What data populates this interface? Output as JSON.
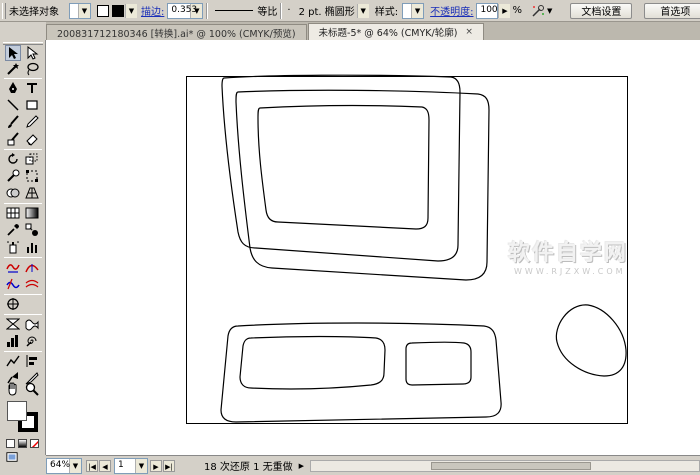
{
  "control_bar": {
    "selection_label": "未选择对象",
    "stroke_label": "描边:",
    "stroke_weight": "0.353",
    "profile_label": "等比",
    "brush_label": "2 pt. 椭圆形",
    "brush_dot": "·",
    "style_label": "样式:",
    "opacity_label": "不透明度:",
    "opacity_value": "100",
    "percent": "%",
    "doc_setup_button": "文档设置",
    "prefs_button": "首选项"
  },
  "tabs": [
    {
      "label": "2008317121803​46 [转换].ai* @ 100% (CMYK/预览)"
    },
    {
      "label": "未标题-5* @ 64% (CMYK/轮廓)",
      "close": "×"
    }
  ],
  "status_bar": {
    "zoom": "64%",
    "page": "1",
    "status_text": "18 次还原 1 无重做"
  },
  "watermark": {
    "main": "软件自学网",
    "sub": "WWW.RJZXW.COM"
  },
  "colors": {
    "chrome": "#d4d0c8",
    "canvas": "#ffffff",
    "link_blue": "#1a2fb8",
    "selected_tool": "#c2ccdb"
  }
}
